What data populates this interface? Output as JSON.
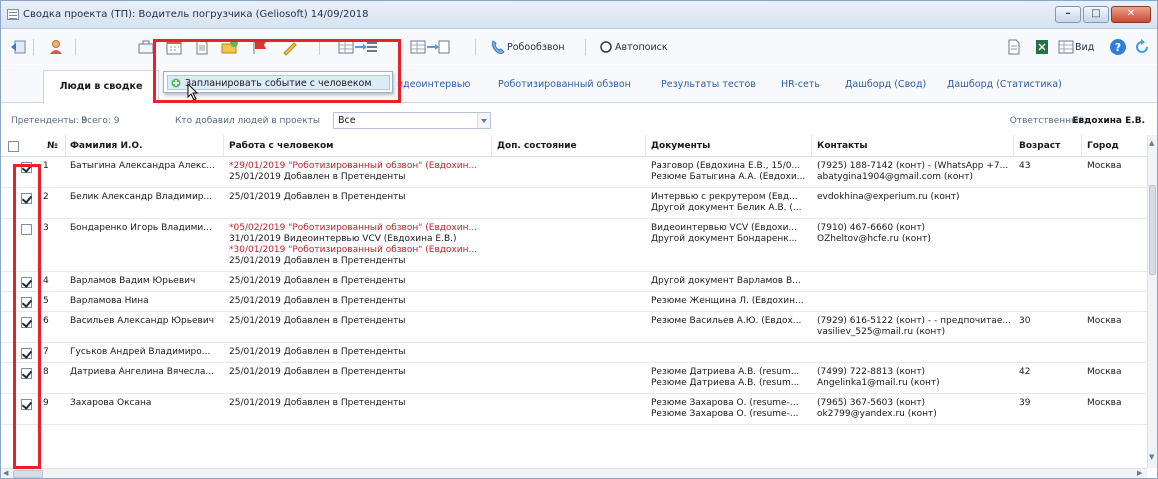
{
  "window": {
    "title": "Сводка проекта (ТП): Водитель погрузчика (Geliosoft) 14/09/2018"
  },
  "toolbar": {
    "robocall_label": "Робообзвон",
    "autosearch_label": "Автопоиск",
    "view_label": "Вид"
  },
  "tabs": [
    {
      "label": "Люди в сводке"
    },
    {
      "label": "идеоинтервью"
    },
    {
      "label": "Роботизированный обзвон"
    },
    {
      "label": "Результаты тестов"
    },
    {
      "label": "HR-сеть"
    },
    {
      "label": "Дашборд (Свод)"
    },
    {
      "label": "Дашборд (Статистика)"
    }
  ],
  "popup": {
    "item_label": "Запланировать событие с человеком"
  },
  "filter": {
    "candidates": "Претенденты: 9",
    "total": "Всего: 9",
    "added_by_label": "Кто добавил людей в проекты",
    "added_by_value": "Все",
    "responsible_label": "Ответственный:",
    "responsible_value": "Евдохина Е.В."
  },
  "columns": {
    "num": "№",
    "name": "Фамилия И.О.",
    "work": "Работа с человеком",
    "state": "Доп. состояние",
    "docs": "Документы",
    "contacts": "Контакты",
    "age": "Возраст",
    "city": "Город"
  },
  "rows": [
    {
      "checked": true,
      "num": "1",
      "name": "Батыгина Александра Алекс...",
      "work": [
        {
          "text": "*29/01/2019 \"Роботизированный обзвон\" (Евдохин...",
          "red": true
        },
        {
          "text": "25/01/2019 Добавлен в Претенденты",
          "red": false
        }
      ],
      "docs": [
        "Разговор (Евдохина Е.В., 15/0...",
        "Резюме Батыгина А.А. (Евдохи..."
      ],
      "contacts": [
        "(7925) 188-7142 (конт) - (WhatsApp +7...",
        "abatygina1904@gmail.com (конт)"
      ],
      "age": "43",
      "city": "Москва"
    },
    {
      "checked": true,
      "num": "2",
      "name": "Белик Александр Владимир...",
      "work": [
        {
          "text": "25/01/2019 Добавлен в Претенденты",
          "red": false
        }
      ],
      "docs": [
        "Интервью с рекрутером (Евд...",
        "Другой документ Белик А.В. (..."
      ],
      "contacts": [
        "evdokhina@experium.ru (конт)"
      ],
      "age": "",
      "city": ""
    },
    {
      "checked": false,
      "num": "3",
      "name": "Бондаренко Игорь Владими...",
      "work": [
        {
          "text": "*05/02/2019 \"Роботизированный обзвон\" (Евдохин...",
          "red": true
        },
        {
          "text": "31/01/2019 Видеоинтервью VCV (Евдохина Е.В.)",
          "red": false
        },
        {
          "text": "*30/01/2019 \"Роботизированный обзвон\" (Евдохин...",
          "red": true
        },
        {
          "text": "25/01/2019 Добавлен в Претенденты",
          "red": false
        }
      ],
      "docs": [
        "Видеоинтервью VCV (Евдохи...",
        "Другой документ Бондаренк..."
      ],
      "contacts": [
        "(7910) 467-6660 (конт)",
        "OZheltov@hcfe.ru (конт)"
      ],
      "age": "",
      "city": ""
    },
    {
      "checked": true,
      "num": "4",
      "name": "Варламов Вадим Юрьевич",
      "work": [
        {
          "text": "25/01/2019 Добавлен в Претенденты",
          "red": false
        }
      ],
      "docs": [
        "Другой документ Варламов В..."
      ],
      "contacts": [],
      "age": "",
      "city": ""
    },
    {
      "checked": true,
      "num": "5",
      "name": "Варламова Нина",
      "work": [
        {
          "text": "25/01/2019 Добавлен в Претенденты",
          "red": false
        }
      ],
      "docs": [
        "Резюме Женщина Л. (Евдохин..."
      ],
      "contacts": [],
      "age": "",
      "city": ""
    },
    {
      "checked": true,
      "num": "6",
      "name": "Васильев Александр Юрьевич",
      "work": [
        {
          "text": "25/01/2019 Добавлен в Претенденты",
          "red": false
        }
      ],
      "docs": [
        "Резюме Васильев А.Ю. (Евдох..."
      ],
      "contacts": [
        "(7929) 616-5122 (конт) - - предпочитае...",
        "vasiliev_525@mail.ru (конт)"
      ],
      "age": "30",
      "city": "Москва"
    },
    {
      "checked": true,
      "num": "7",
      "name": "Гуськов Андрей Владимиро...",
      "work": [
        {
          "text": "25/01/2019 Добавлен в Претенденты",
          "red": false
        }
      ],
      "docs": [],
      "contacts": [],
      "age": "",
      "city": ""
    },
    {
      "checked": true,
      "num": "8",
      "name": "Датриева Ангелина Вячесла...",
      "work": [
        {
          "text": "25/01/2019 Добавлен в Претенденты",
          "red": false
        }
      ],
      "docs": [
        "Резюме Датриева А.В. (resum...",
        "Резюме Датриева А.В. (resum..."
      ],
      "contacts": [
        "(7499) 722-8813 (конт)",
        "Angelinka1@mail.ru (конт)"
      ],
      "age": "42",
      "city": "Москва"
    },
    {
      "checked": true,
      "num": "9",
      "name": "Захарова Оксана",
      "work": [
        {
          "text": "25/01/2019 Добавлен в Претенденты",
          "red": false
        }
      ],
      "docs": [
        "Резюме Захарова О. (resume-...",
        "Резюме Захарова О. (resume-..."
      ],
      "contacts": [
        "(7965) 367-5603 (конт)",
        "ok2799@yandex.ru (конт)"
      ],
      "age": "39",
      "city": "Москва"
    }
  ],
  "colors": {
    "highlight": "#e8212b",
    "link": "#2b5ea6",
    "red_text": "#c81e2a"
  }
}
